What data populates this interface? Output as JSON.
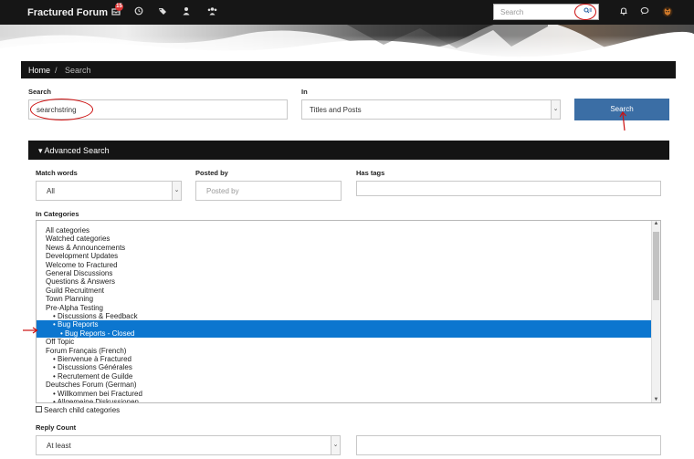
{
  "header": {
    "brand": "Fractured Forum",
    "notification_count": "15",
    "icons": [
      "inbox-icon",
      "clock-icon",
      "tag-icon",
      "user-icon",
      "users-icon"
    ],
    "search_placeholder": "Search",
    "right_icons": [
      "bell-icon",
      "chat-icon",
      "avatar-icon"
    ]
  },
  "breadcrumb": {
    "home": "Home",
    "separator": "/",
    "current": "Search"
  },
  "search_form": {
    "search_label": "Search",
    "search_value": "searchstring",
    "in_label": "In",
    "in_value": "Titles and Posts",
    "search_button": "Search"
  },
  "advanced": {
    "title": "Advanced Search",
    "match_words_label": "Match words",
    "match_words_value": "All",
    "posted_by_label": "Posted by",
    "posted_by_placeholder": "Posted by",
    "has_tags_label": "Has tags",
    "categories_label": "In Categories",
    "categories": [
      {
        "label": "All categories",
        "indent": 0,
        "selected": false
      },
      {
        "label": "Watched categories",
        "indent": 0,
        "selected": false
      },
      {
        "label": "News & Announcements",
        "indent": 0,
        "selected": false
      },
      {
        "label": "Development Updates",
        "indent": 0,
        "selected": false
      },
      {
        "label": "Welcome to Fractured",
        "indent": 0,
        "selected": false
      },
      {
        "label": "General Discussions",
        "indent": 0,
        "selected": false
      },
      {
        "label": "Questions & Answers",
        "indent": 0,
        "selected": false
      },
      {
        "label": "Guild Recruitment",
        "indent": 0,
        "selected": false
      },
      {
        "label": "Town Planning",
        "indent": 0,
        "selected": false
      },
      {
        "label": "Pre-Alpha Testing",
        "indent": 0,
        "selected": false
      },
      {
        "label": "• Discussions & Feedback",
        "indent": 1,
        "selected": false
      },
      {
        "label": "• Bug Reports",
        "indent": 1,
        "selected": true
      },
      {
        "label": "• Bug Reports - Closed",
        "indent": 2,
        "selected": true
      },
      {
        "label": "Off Topic",
        "indent": 0,
        "selected": false
      },
      {
        "label": "Forum Français (French)",
        "indent": 0,
        "selected": false
      },
      {
        "label": "• Bienvenue à Fractured",
        "indent": 1,
        "selected": false
      },
      {
        "label": "• Discussions Générales",
        "indent": 1,
        "selected": false
      },
      {
        "label": "• Recrutement de Guilde",
        "indent": 1,
        "selected": false
      },
      {
        "label": "Deutsches Forum (German)",
        "indent": 0,
        "selected": false
      },
      {
        "label": "• Willkommen bei Fractured",
        "indent": 1,
        "selected": false
      },
      {
        "label": "• Allgemeine Diskussionen",
        "indent": 1,
        "selected": false
      }
    ],
    "search_child_label": "Search child categories",
    "search_child_checked": false,
    "reply_count_label": "Reply Count",
    "reply_count_value": "At least"
  },
  "colors": {
    "topbar": "#161616",
    "accent": "#3b6ea5",
    "selection": "#0c76cf",
    "annotation": "#cc1010"
  }
}
